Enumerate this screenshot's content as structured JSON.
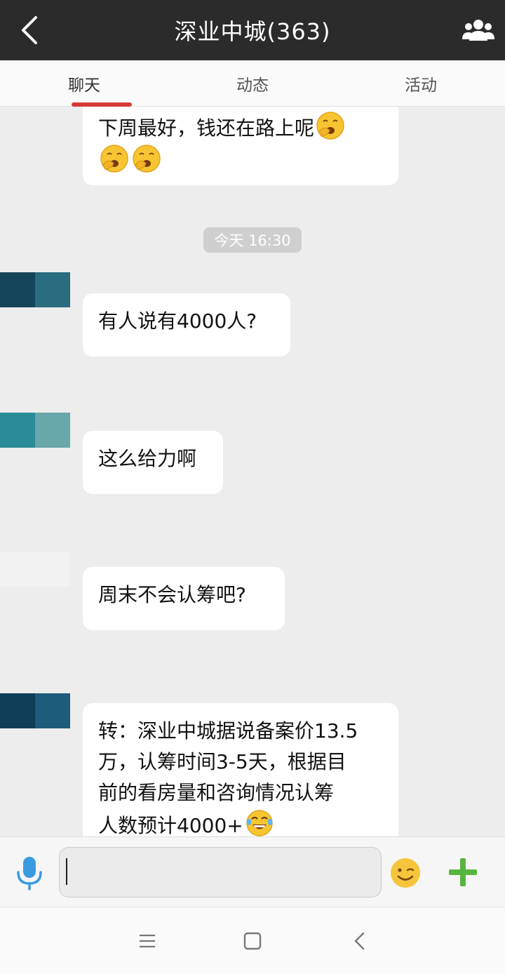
{
  "header": {
    "title": "深业中城(363)",
    "back_icon": "chevron-left-icon",
    "group_icon": "group-members-icon"
  },
  "tabs": [
    {
      "label": "聊天",
      "active": true
    },
    {
      "label": "动态",
      "active": false
    },
    {
      "label": "活动",
      "active": false
    }
  ],
  "accent_color": "#d73a35",
  "messages": [
    {
      "line1": "下周最好，钱还在路上呢",
      "emoji": "yawning-face"
    },
    {
      "time": "今天 16:30"
    },
    {
      "text": "有人说有4000人?"
    },
    {
      "text": "这么给力啊"
    },
    {
      "text": "周末不会认筹吧?"
    },
    {
      "lines": [
        "转：深业中城据说备案价13.5",
        "万，认筹时间3-5天，根据目",
        "前的看房量和咨询情况认筹",
        "人数预计4000+"
      ],
      "emoji": "tears-of-joy-face"
    }
  ],
  "input": {
    "value": "",
    "mic_icon": "microphone-icon",
    "emoji_icon": "smiley-face-icon",
    "plus_icon": "plus-icon"
  },
  "navbar": {
    "menu_icon": "menu-icon",
    "home_icon": "home-square-icon",
    "back_icon": "back-triangle-icon"
  }
}
